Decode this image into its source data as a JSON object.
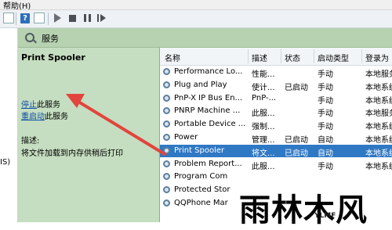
{
  "menu": {
    "help": "帮助(H)"
  },
  "toolbar": {
    "help_glyph": "?"
  },
  "left_fragment": "IS)",
  "panel": {
    "title": "服务"
  },
  "desc": {
    "service_name": "Print Spooler",
    "stop_link": "停止",
    "stop_suffix": "此服务",
    "restart_link": "重启动",
    "restart_suffix": "此服务",
    "desc_label": "描述:",
    "desc_text": "将文件加载到内存供稍后打印"
  },
  "columns": [
    "名称",
    "描述",
    "状态",
    "启动类型",
    "登录为"
  ],
  "rows": [
    {
      "name": "Performance Lo...",
      "desc": "性能...",
      "status": "",
      "startup": "手动",
      "logon": "本地服务"
    },
    {
      "name": "Plug and Play",
      "desc": "使计...",
      "status": "已启动",
      "startup": "手动",
      "logon": "本地系统"
    },
    {
      "name": "PnP-X IP Bus En...",
      "desc": "PnP-...",
      "status": "",
      "startup": "手动",
      "logon": "本地系统"
    },
    {
      "name": "PNRP Machine ...",
      "desc": "此服...",
      "status": "",
      "startup": "手动",
      "logon": "本地服务"
    },
    {
      "name": "Portable Device ...",
      "desc": "强制...",
      "status": "",
      "startup": "手动",
      "logon": "本地系统"
    },
    {
      "name": "Power",
      "desc": "管理...",
      "status": "已启动",
      "startup": "自动",
      "logon": "本地系统"
    },
    {
      "name": "Print Spooler",
      "desc": "将文...",
      "status": "已启动",
      "startup": "自动",
      "logon": "本地系统"
    },
    {
      "name": "Problem Report...",
      "desc": "此服...",
      "status": "",
      "startup": "手动",
      "logon": "本地系统"
    },
    {
      "name": "Program Com",
      "desc": "",
      "status": "",
      "startup": "",
      "logon": ""
    },
    {
      "name": "Protected Stor",
      "desc": "",
      "status": "",
      "startup": "",
      "logon": ""
    },
    {
      "name": "QQPhone Mar",
      "desc": "",
      "status": "",
      "startup": "",
      "logon": ""
    }
  ],
  "selected_row": 6,
  "watermark": {
    "big": "雨林木风",
    "small": "YLMF"
  },
  "colors": {
    "panel_bg": "#c5ddc0",
    "selected": "#2f78c4",
    "arrow": "#e2453c",
    "link": "#0c4ea3"
  }
}
